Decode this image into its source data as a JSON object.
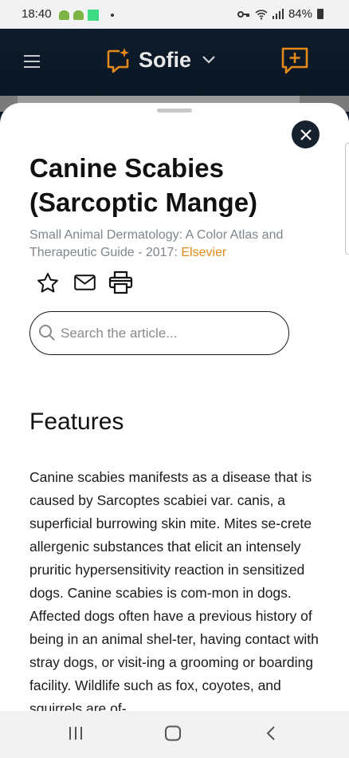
{
  "status_bar": {
    "time": "18:40",
    "battery": "84%",
    "notification_icons": [
      "android-icon",
      "android-icon",
      "app-square-icon",
      "dot-icon"
    ],
    "system_icons": [
      "key-icon",
      "wifi-icon",
      "signal-icon",
      "battery-icon"
    ]
  },
  "app_bar": {
    "title": "Sofie",
    "icons": [
      "hamburger-menu-icon",
      "sofie-chat-icon",
      "chevron-down-icon",
      "new-chat-icon"
    ],
    "accent_color": "#e48a1b",
    "background_color": "#0e1b2b"
  },
  "article": {
    "title": "Canine Scabies (Sarcoptic Mange)",
    "source": "Small Animal Dermatology: A Color Atlas and Therapeutic Guide - 2017: ",
    "publisher": "Elsevier",
    "actions": [
      "star-icon",
      "mail-icon",
      "print-icon"
    ],
    "search": {
      "placeholder": "Search the article...",
      "value": ""
    },
    "section_heading": "Features",
    "body": "Canine scabies manifests as a disease that is caused by Sarcoptes scabiei var. canis, a superficial burrowing skin mite. Mites se-crete allergenic substances that elicit an intensely pruritic hypersensitivity reaction in sensitized dogs. Canine scabies is com-mon in dogs. Affected dogs often have a previous history of being in an animal shel-ter, having contact with stray dogs, or visit-ing a grooming or boarding facility. Wildlife such as fox, coyotes, and squirrels are of-"
  },
  "nav_bar": {
    "icons": [
      "recent-apps-icon",
      "home-icon",
      "back-icon"
    ],
    "background_color": "#f2f2f2"
  }
}
